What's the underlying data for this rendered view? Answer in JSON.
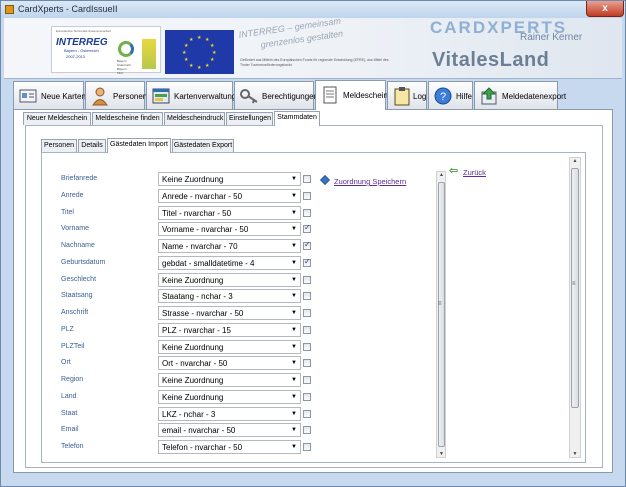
{
  "window": {
    "title": "CardXperts - CardIssueII",
    "close_label": "x"
  },
  "banner": {
    "interreg_small": "Europäische Territoriale Zusammenarbeit",
    "interreg_logo": "INTERREG",
    "interreg_sub": "Bayern - Österreich",
    "interreg_years": "2007-2013",
    "interreg_mini": "Bayern\nÖsterreich\nBayern\nTirol",
    "slogan_line1": "INTERREG – gemeinsam",
    "slogan_line2": "grenzenlos gestalten",
    "fund_note": "Gefördert aus Mitteln des Europäischen Fonds für regionale Entwicklung (EFRE), aus Mittel des Tiroler Tourismusförderungsfonds",
    "brand": "CARDXPERTS",
    "brand_sub": "Rainer Kerner",
    "product": "VitalesLand"
  },
  "main_tabs": [
    {
      "label": "Neue Karten",
      "icon": "new-card-icon"
    },
    {
      "label": "Personen",
      "icon": "person-icon"
    },
    {
      "label": "Kartenverwaltung",
      "icon": "card-admin-icon"
    },
    {
      "label": "Berechtigungen",
      "icon": "keys-icon"
    },
    {
      "label": "Meldeschein",
      "icon": "document-icon",
      "active": true
    },
    {
      "label": "Log",
      "icon": "clipboard-icon"
    },
    {
      "label": "Hilfe",
      "icon": "help-icon"
    },
    {
      "label": "Meldedatenexport",
      "icon": "export-icon"
    }
  ],
  "sub_tabs": [
    {
      "label": "Neuer Meldeschein"
    },
    {
      "label": "Meldescheine finden"
    },
    {
      "label": "Meldescheindruck"
    },
    {
      "label": "Einstellungen"
    },
    {
      "label": "Stammdaten",
      "active": true
    }
  ],
  "inner_tabs": [
    {
      "label": "Personen"
    },
    {
      "label": "Details"
    },
    {
      "label": "Gästedaten Import",
      "active": true
    },
    {
      "label": "Gästedaten Export"
    }
  ],
  "actions": {
    "save_label": "Zuordnung Speichern",
    "back_label": "Zurück"
  },
  "mappings": [
    {
      "field": "Briefanrede",
      "value": "Keine Zuordnung",
      "checked": false
    },
    {
      "field": "Anrede",
      "value": "Anrede - nvarchar - 50",
      "checked": false
    },
    {
      "field": "Titel",
      "value": "Titel - nvarchar - 50",
      "checked": false
    },
    {
      "field": "Vorname",
      "value": "Vorname - nvarchar - 50",
      "checked": true
    },
    {
      "field": "Nachname",
      "value": "Name - nvarchar - 70",
      "checked": true
    },
    {
      "field": "Geburtsdatum",
      "value": "gebdat - smalldatetime - 4",
      "checked": true
    },
    {
      "field": "Geschlecht",
      "value": "Keine Zuordnung",
      "checked": false
    },
    {
      "field": "Staatsang",
      "value": "Staatang - nchar - 3",
      "checked": false
    },
    {
      "field": "Anschrift",
      "value": "Strasse - nvarchar - 50",
      "checked": false
    },
    {
      "field": "PLZ",
      "value": "PLZ - nvarchar - 15",
      "checked": false
    },
    {
      "field": "PLZTeil",
      "value": "Keine Zuordnung",
      "checked": false
    },
    {
      "field": "Ort",
      "value": "Ort - nvarchar - 50",
      "checked": false
    },
    {
      "field": "Region",
      "value": "Keine Zuordnung",
      "checked": false
    },
    {
      "field": "Land",
      "value": "Keine Zuordnung",
      "checked": false
    },
    {
      "field": "Staat",
      "value": "LKZ - nchar - 3",
      "checked": false
    },
    {
      "field": "Email",
      "value": "email - nvarchar - 50",
      "checked": false
    },
    {
      "field": "Telefon",
      "value": "Telefon - nvarchar - 50",
      "checked": false
    }
  ],
  "colors": {
    "field_label": "#3a5f95",
    "link": "#5e2b9c",
    "window_bg": "#c6d9ee"
  }
}
